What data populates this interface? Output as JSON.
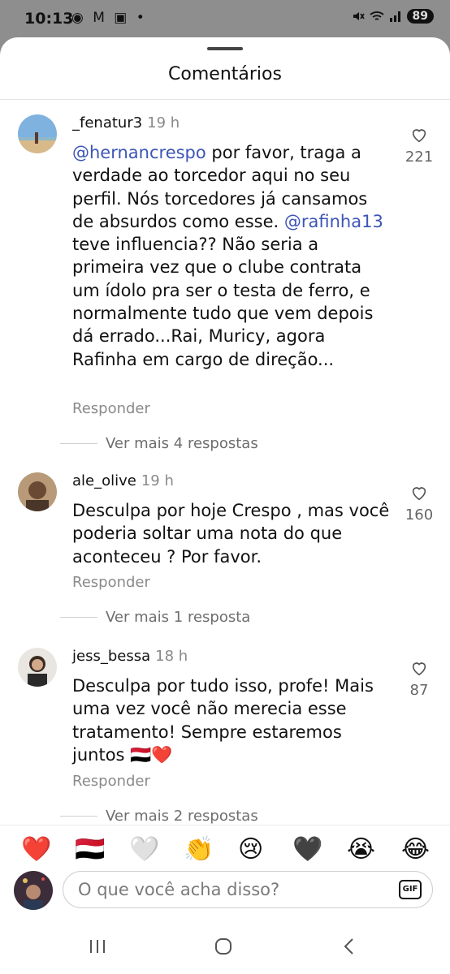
{
  "status_bar": {
    "time": "10:13",
    "left_icons": "◉ M ▣ •",
    "battery": "89"
  },
  "sheet": {
    "title": "Comentários"
  },
  "comments": [
    {
      "username": "_fenatur3",
      "time": "19 h",
      "mention1": "@hernancrespo",
      "text1": " por favor, traga a verdade ao torcedor aqui no seu perfil. Nós torcedores já cansamos de absurdos como esse. ",
      "mention2": "@rafinha13",
      "text2": " teve influencia?? Não seria a primeira vez que o clube contrata um ídolo pra ser o testa de ferro, e normalmente tudo que vem depois dá errado...Rai, Muricy, agora Rafinha em cargo de direção...",
      "reply": "Responder",
      "likes": "221",
      "more_replies": "Ver mais 4 respostas"
    },
    {
      "username": "ale_olive",
      "time": "19 h",
      "text": "Desculpa por hoje Crespo , mas você poderia soltar uma nota do que aconteceu ? Por favor.",
      "reply": "Responder",
      "likes": "160",
      "more_replies": "Ver mais 1 resposta"
    },
    {
      "username": "jess_bessa",
      "time": "18 h",
      "text": "Desculpa por tudo isso, profe! Mais uma vez você não merecia esse tratamento! Sempre estaremos juntos 🇾🇪❤️",
      "reply": "Responder",
      "likes": "87",
      "more_replies": "Ver mais 2 respostas"
    }
  ],
  "reactions": [
    "❤️",
    "🇾🇪",
    "🤍",
    "👏",
    "😢",
    "🖤",
    "😭",
    "😂"
  ],
  "composer": {
    "placeholder": "O que você acha disso?",
    "gif_label": "GIF"
  },
  "colors": {
    "mention": "#3c55b5",
    "secondary_text": "#8a8a8a"
  }
}
